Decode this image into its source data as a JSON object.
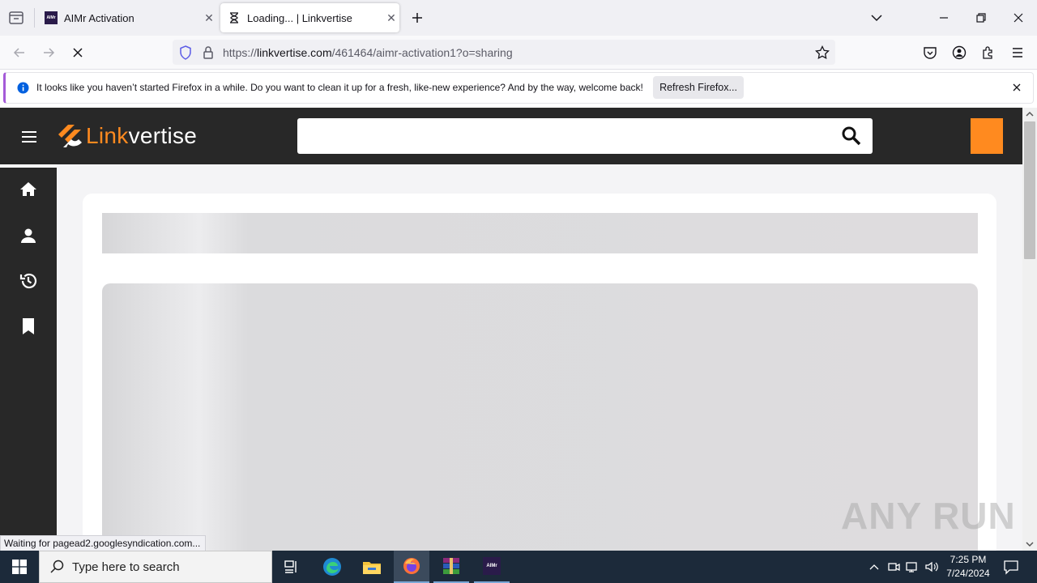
{
  "browser": {
    "tabs": [
      {
        "title": "AIMr Activation",
        "favicon_text": "AIMr"
      },
      {
        "title": "Loading... | Linkvertise"
      }
    ],
    "url_prefix": "https://",
    "url_host": "linkvertise.com",
    "url_path": "/461464/aimr-activation1?o=sharing",
    "notification": {
      "text": "It looks like you haven’t started Firefox in a while. Do you want to clean it up for a fresh, like-new experience? And by the way, welcome back!",
      "button": "Refresh Firefox..."
    },
    "status_text": "Waiting for pagead2.googlesyndication.com..."
  },
  "page": {
    "logo_accent": "Link",
    "logo_rest": "vertise",
    "brand_color": "#ff8a1f",
    "header_color": "#282828",
    "search_value": ""
  },
  "watermark": "ANY RUN",
  "taskbar": {
    "search_placeholder": "Type here to search",
    "time": "7:25 PM",
    "date": "7/24/2024",
    "aimr_icon_text": "AIMr"
  }
}
